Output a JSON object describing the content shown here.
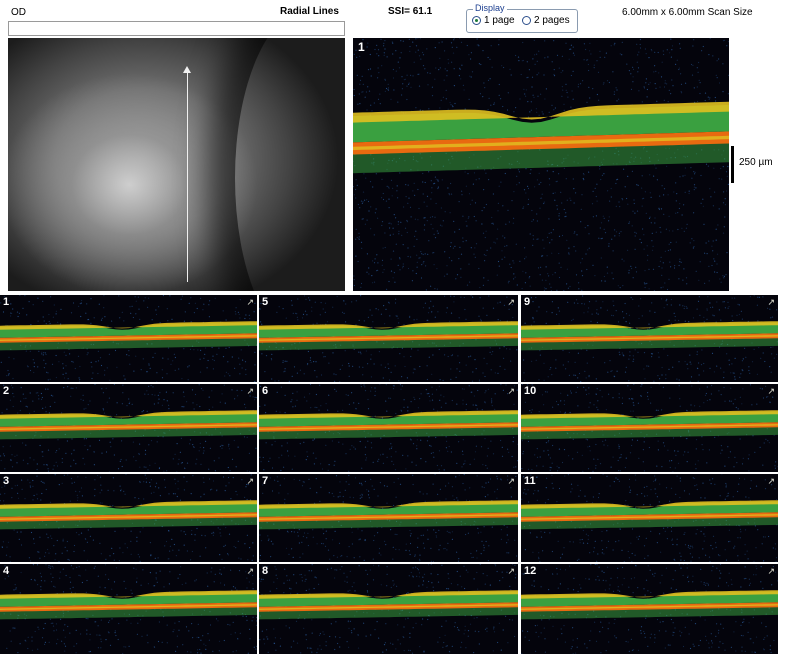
{
  "header": {
    "eye": "OD",
    "scan_type": "Radial Lines",
    "ssi": "SSI= 61.1",
    "scan_size": "6.00mm x 6.00mm Scan Size"
  },
  "display": {
    "legend": "Display",
    "options": [
      {
        "label": "1 page",
        "selected": true
      },
      {
        "label": "2 pages",
        "selected": false
      }
    ]
  },
  "main_scan": {
    "number": "1",
    "scale_label": "250 µm"
  },
  "thumbnails": [
    "1",
    "2",
    "3",
    "4",
    "5",
    "6",
    "7",
    "8",
    "9",
    "10",
    "11",
    "12"
  ],
  "colors": {
    "background": "#04040c",
    "rnfl": "#e0c020",
    "retina": "#3aa040",
    "rpe": "#e86a10",
    "noise": "#2a5a9a"
  }
}
